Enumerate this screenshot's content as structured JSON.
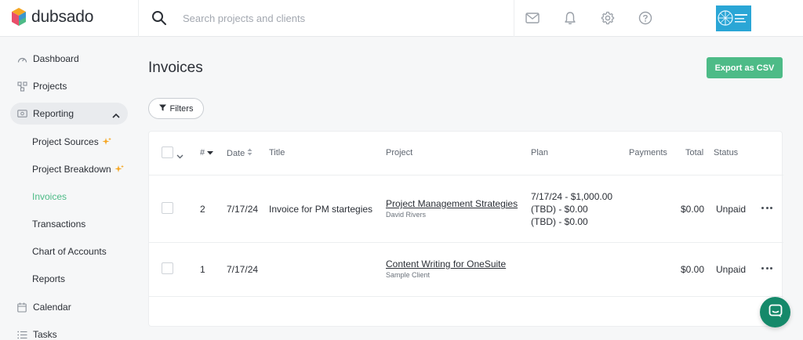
{
  "app": {
    "logo_text": "dubsado"
  },
  "search": {
    "placeholder": "Search projects and clients",
    "value": ""
  },
  "header_icons": [
    "mail-icon",
    "bell-icon",
    "gear-icon",
    "help-icon"
  ],
  "sidebar": {
    "items": [
      {
        "label": "Dashboard",
        "icon": "dashboard-icon"
      },
      {
        "label": "Projects",
        "icon": "projects-icon"
      },
      {
        "label": "Reporting",
        "icon": "reporting-icon",
        "expanded": true
      },
      {
        "label": "Calendar",
        "icon": "calendar-icon"
      },
      {
        "label": "Tasks",
        "icon": "tasks-icon"
      }
    ],
    "reporting_sub": [
      {
        "label": "Project Sources",
        "sparkle": true
      },
      {
        "label": "Project Breakdown",
        "sparkle": true
      },
      {
        "label": "Invoices",
        "active": true
      },
      {
        "label": "Transactions"
      },
      {
        "label": "Chart of Accounts"
      },
      {
        "label": "Reports"
      }
    ]
  },
  "main": {
    "title": "Invoices",
    "export_label": "Export as CSV",
    "filters_label": "Filters"
  },
  "table": {
    "columns": [
      "#",
      "Date",
      "Title",
      "Project",
      "Plan",
      "Payments",
      "Total",
      "Status"
    ],
    "rows": [
      {
        "number": "2",
        "date": "7/17/24",
        "title": "Invoice for PM startegies",
        "project": "Project Management Strategies",
        "client": "David Rivers",
        "plan": [
          "7/17/24 - $1,000.00",
          "(TBD) - $0.00",
          "(TBD) - $0.00"
        ],
        "payments": "",
        "total": "$0.00",
        "status": "Unpaid"
      },
      {
        "number": "1",
        "date": "7/17/24",
        "title": "",
        "project": "Content Writing for OneSuite",
        "client": "Sample Client",
        "plan": [],
        "payments": "",
        "total": "$0.00",
        "status": "Unpaid"
      }
    ]
  },
  "colors": {
    "accent": "#4dbb87",
    "chat": "#15896a",
    "sparkle": "#f5a623"
  }
}
